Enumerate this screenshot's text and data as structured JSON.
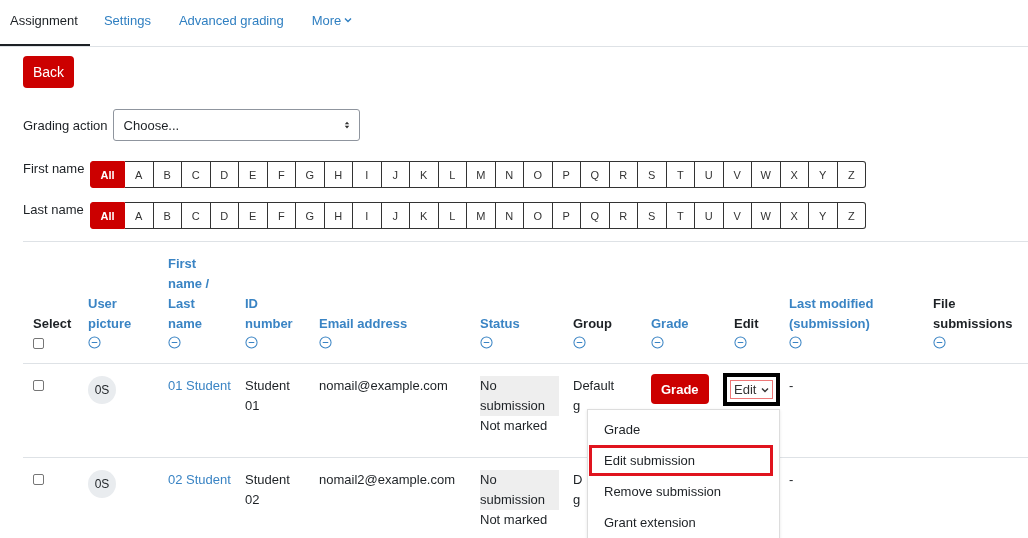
{
  "tabs": [
    {
      "label": "Assignment",
      "selected": true,
      "dropdown": false
    },
    {
      "label": "Settings",
      "selected": false,
      "dropdown": false
    },
    {
      "label": "Advanced grading",
      "selected": false,
      "dropdown": false
    },
    {
      "label": "More",
      "selected": false,
      "dropdown": true
    }
  ],
  "back_button": "Back",
  "grading_action": {
    "label": "Grading action",
    "value": "Choose..."
  },
  "name_filters": [
    {
      "label": "First name",
      "letters": [
        {
          "label": "All",
          "selected": true
        },
        {
          "label": "A",
          "selected": false
        },
        {
          "label": "B",
          "selected": false
        },
        {
          "label": "C",
          "selected": false
        },
        {
          "label": "D",
          "selected": false
        },
        {
          "label": "E",
          "selected": false
        },
        {
          "label": "F",
          "selected": false
        },
        {
          "label": "G",
          "selected": false
        },
        {
          "label": "H",
          "selected": false
        },
        {
          "label": "I",
          "selected": false
        },
        {
          "label": "J",
          "selected": false
        },
        {
          "label": "K",
          "selected": false
        },
        {
          "label": "L",
          "selected": false
        },
        {
          "label": "M",
          "selected": false
        },
        {
          "label": "N",
          "selected": false
        },
        {
          "label": "O",
          "selected": false
        },
        {
          "label": "P",
          "selected": false
        },
        {
          "label": "Q",
          "selected": false
        },
        {
          "label": "R",
          "selected": false
        },
        {
          "label": "S",
          "selected": false
        },
        {
          "label": "T",
          "selected": false
        },
        {
          "label": "U",
          "selected": false
        },
        {
          "label": "V",
          "selected": false
        },
        {
          "label": "W",
          "selected": false
        },
        {
          "label": "X",
          "selected": false
        },
        {
          "label": "Y",
          "selected": false
        },
        {
          "label": "Z",
          "selected": false
        }
      ]
    },
    {
      "label": "Last name",
      "letters": [
        {
          "label": "All",
          "selected": true
        },
        {
          "label": "A",
          "selected": false
        },
        {
          "label": "B",
          "selected": false
        },
        {
          "label": "C",
          "selected": false
        },
        {
          "label": "D",
          "selected": false
        },
        {
          "label": "E",
          "selected": false
        },
        {
          "label": "F",
          "selected": false
        },
        {
          "label": "G",
          "selected": false
        },
        {
          "label": "H",
          "selected": false
        },
        {
          "label": "I",
          "selected": false
        },
        {
          "label": "J",
          "selected": false
        },
        {
          "label": "K",
          "selected": false
        },
        {
          "label": "L",
          "selected": false
        },
        {
          "label": "M",
          "selected": false
        },
        {
          "label": "N",
          "selected": false
        },
        {
          "label": "O",
          "selected": false
        },
        {
          "label": "P",
          "selected": false
        },
        {
          "label": "Q",
          "selected": false
        },
        {
          "label": "R",
          "selected": false
        },
        {
          "label": "S",
          "selected": false
        },
        {
          "label": "T",
          "selected": false
        },
        {
          "label": "U",
          "selected": false
        },
        {
          "label": "V",
          "selected": false
        },
        {
          "label": "W",
          "selected": false
        },
        {
          "label": "X",
          "selected": false
        },
        {
          "label": "Y",
          "selected": false
        },
        {
          "label": "Z",
          "selected": false
        }
      ]
    }
  ],
  "table": {
    "columns": [
      {
        "label": "Select",
        "kind": "checkbox",
        "checked": false
      },
      {
        "label": "User picture",
        "kind": "link"
      },
      {
        "label": "First name / Last name",
        "kind": "link"
      },
      {
        "label": "ID number",
        "kind": "link"
      },
      {
        "label": "Email address",
        "kind": "link"
      },
      {
        "label": "Status",
        "kind": "link"
      },
      {
        "label": "Group",
        "kind": "plain"
      },
      {
        "label": "Grade",
        "kind": "link"
      },
      {
        "label": "Edit",
        "kind": "plain"
      },
      {
        "label": "Last modified (submission)",
        "kind": "link"
      },
      {
        "label": "File submissions",
        "kind": "plain"
      }
    ],
    "rows": [
      {
        "checked": false,
        "avatar": "0S",
        "name": "01 Student",
        "id_number": "Student 01",
        "email": "nomail@example.com",
        "status": "No submission",
        "grading_status": "Not marked",
        "group": [
          "Default",
          "g"
        ],
        "grade_button": "Grade",
        "edit": {
          "label": "Edit",
          "highlighted": true
        },
        "last_modified": "-"
      },
      {
        "checked": false,
        "avatar": "0S",
        "name": "02 Student",
        "id_number": "Student 02",
        "email": "nomail2@example.com",
        "status": "No submission",
        "grading_status": "Not marked",
        "group": [
          "D",
          "g"
        ],
        "last_modified": "-"
      }
    ]
  },
  "edit_menu": {
    "items": [
      {
        "label": "Grade",
        "highlighted": false
      },
      {
        "label": "Edit submission",
        "highlighted": true
      },
      {
        "label": "Remove submission",
        "highlighted": false
      },
      {
        "label": "Grant extension",
        "highlighted": false
      }
    ]
  }
}
